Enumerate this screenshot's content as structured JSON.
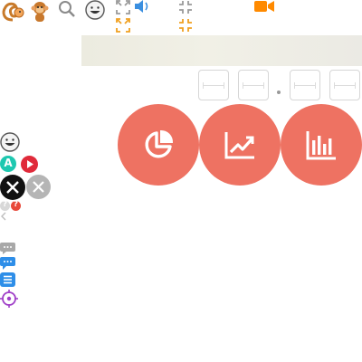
{
  "toolbar": {
    "icons": [
      "squirrel-icon",
      "monkey-icon",
      "search-icon",
      "smiley-icon",
      "expand-icon",
      "speaker-icon",
      "compress-icon",
      "video-camera-icon"
    ],
    "accent_orange": "#f0a020",
    "speaker_blue": "#3a8fe0",
    "camera_orange": "#ff8a00"
  },
  "inputs": [
    {
      "value": ""
    },
    {
      "value": ""
    },
    {
      "value": ""
    },
    {
      "value": ""
    }
  ],
  "actions": {
    "color": "#ee7262",
    "buttons": [
      "pie-chart-icon",
      "trend-line-icon",
      "bar-chart-icon"
    ]
  },
  "sidebar": {
    "icons": [
      "smiley-icon",
      "letter-a-icon",
      "play-icon",
      "close-icon",
      "close-icon",
      "help-icon",
      "help-icon",
      "chat-icon",
      "chat-icon",
      "list-icon",
      "target-icon"
    ],
    "letter_a": "A",
    "help_mark": "?"
  }
}
